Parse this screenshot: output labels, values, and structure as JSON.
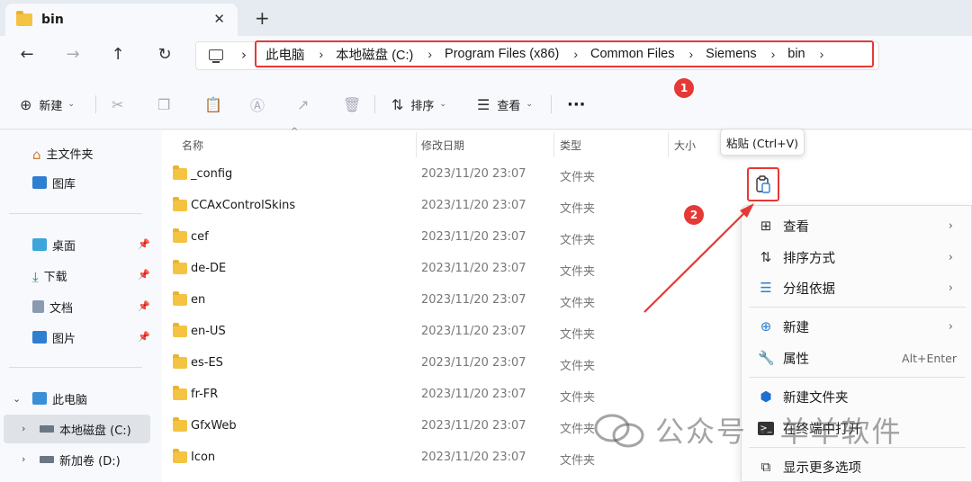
{
  "tab": {
    "title": "bin",
    "close": "✕",
    "new": "+"
  },
  "nav": {
    "back": "←",
    "forward": "→",
    "up": "↑",
    "refresh": "↻"
  },
  "breadcrumb": [
    "此电脑",
    "本地磁盘 (C:)",
    "Program Files (x86)",
    "Common Files",
    "Siemens",
    "bin"
  ],
  "toolbar": {
    "new": "新建",
    "sort": "排序",
    "view": "查看",
    "more": "···"
  },
  "sidebar": {
    "quick": [
      "主文件夹",
      "图库"
    ],
    "pinned": [
      "桌面",
      "下载",
      "文档",
      "图片"
    ],
    "this_pc": "此电脑",
    "drives": [
      "本地磁盘 (C:)",
      "新加卷 (D:)"
    ]
  },
  "columns": {
    "name": "名称",
    "date": "修改日期",
    "type": "类型",
    "size": "大小"
  },
  "files": [
    {
      "name": "_config",
      "date": "2023/11/20 23:07",
      "type": "文件夹"
    },
    {
      "name": "CCAxControlSkins",
      "date": "2023/11/20 23:07",
      "type": "文件夹"
    },
    {
      "name": "cef",
      "date": "2023/11/20 23:07",
      "type": "文件夹"
    },
    {
      "name": "de-DE",
      "date": "2023/11/20 23:07",
      "type": "文件夹"
    },
    {
      "name": "en",
      "date": "2023/11/20 23:07",
      "type": "文件夹"
    },
    {
      "name": "en-US",
      "date": "2023/11/20 23:07",
      "type": "文件夹"
    },
    {
      "name": "es-ES",
      "date": "2023/11/20 23:07",
      "type": "文件夹"
    },
    {
      "name": "fr-FR",
      "date": "2023/11/20 23:07",
      "type": "文件夹"
    },
    {
      "name": "GfxWeb",
      "date": "2023/11/20 23:07",
      "type": "文件夹"
    },
    {
      "name": "Icon",
      "date": "2023/11/20 23:07",
      "type": "文件夹"
    }
  ],
  "tooltip": "粘贴 (Ctrl+V)",
  "context_menu": {
    "view": "查看",
    "sort_by": "排序方式",
    "group_by": "分组依据",
    "new": "新建",
    "properties": "属性",
    "properties_shortcut": "Alt+Enter",
    "new_folder": "新建文件夹",
    "open_terminal": "在终端中打开",
    "show_more": "显示更多选项"
  },
  "annotations": {
    "badge1": "1",
    "badge2": "2"
  },
  "watermark": "公众号 · 羊羊软件",
  "colors": {
    "accent": "#e53935",
    "folder": "#f5c342",
    "selection": "#dfe3e8"
  }
}
